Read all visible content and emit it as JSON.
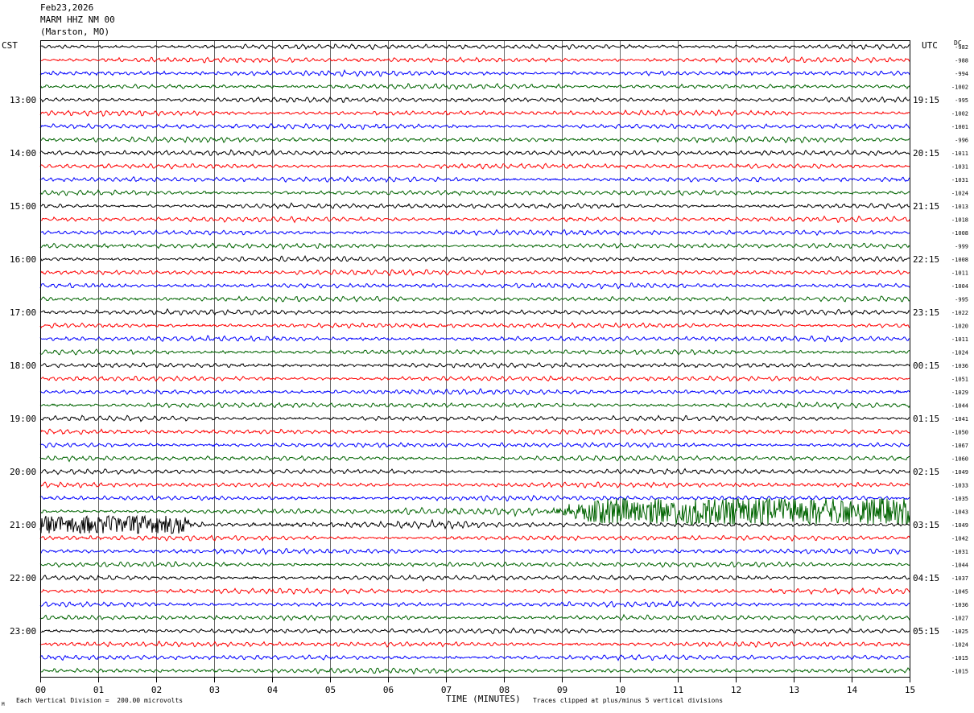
{
  "header": {
    "date": "Feb23,2026",
    "station": "MARM HHZ NM 00",
    "location": "(Marston, MO)"
  },
  "left_tz": "CST",
  "right_tz": "UTC",
  "dc_label": "DC",
  "footer": {
    "scale_note": "Each Vertical Division =  200.00 microvolts",
    "xlabel": "TIME (MINUTES)",
    "clip_note": "Traces clipped at plus/minus 5 vertical divisions",
    "corner_mark": "M"
  },
  "chart_data": {
    "type": "line",
    "title": "",
    "xlabel": "TIME (MINUTES)",
    "ylabel": "",
    "xlim": [
      0,
      15
    ],
    "x_ticks": [
      "00",
      "01",
      "02",
      "03",
      "04",
      "05",
      "06",
      "07",
      "08",
      "09",
      "10",
      "11",
      "12",
      "13",
      "14",
      "15"
    ],
    "grid": true,
    "trace_colors": [
      "#000000",
      "#ff0000",
      "#0000ff",
      "#006400"
    ],
    "left_hour_labels": [
      "13:00",
      "14:00",
      "15:00",
      "16:00",
      "17:00",
      "18:00",
      "19:00",
      "20:00",
      "21:00",
      "22:00",
      "23:00"
    ],
    "right_hour_labels": [
      "19:15",
      "20:15",
      "21:15",
      "22:15",
      "23:15",
      "00:15",
      "01:15",
      "02:15",
      "03:15",
      "04:15",
      "05:15"
    ],
    "hour_label_start_row": 4,
    "hour_label_every_rows": 4,
    "dc_offsets": [
      -982,
      -988,
      -994,
      -1002,
      -995,
      -1002,
      -1001,
      -996,
      -1011,
      -1031,
      -1031,
      -1024,
      -1013,
      -1018,
      -1008,
      -999,
      -1008,
      -1011,
      -1004,
      -995,
      -1022,
      -1020,
      -1011,
      -1024,
      -1036,
      -1051,
      -1029,
      -1044,
      -1041,
      -1050,
      -1067,
      -1060,
      -1049,
      -1033,
      -1035,
      -1043,
      -1049,
      -1042,
      -1031,
      -1044,
      -1037,
      -1045,
      -1036,
      -1027,
      -1025,
      -1024,
      -1015,
      -1015
    ],
    "event": {
      "description_visible": false,
      "strong_rows": [
        35,
        36
      ],
      "row35_start_min": 8.6,
      "row35_clipped": true,
      "row36_end_min": 2.6
    }
  }
}
